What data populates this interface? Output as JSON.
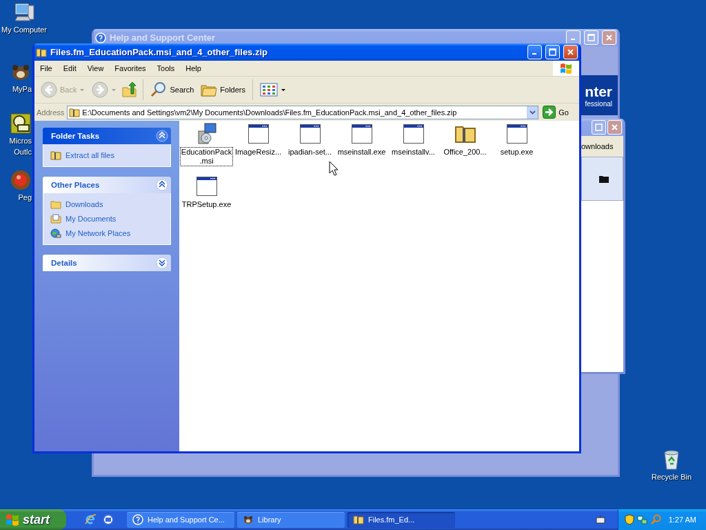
{
  "desktop_icons": [
    {
      "lines": [
        "My Computer"
      ],
      "kind": "computer"
    },
    {
      "lines": [
        "MyPa"
      ],
      "kind": "pets"
    },
    {
      "lines": [
        "Micros",
        "Outlc"
      ],
      "kind": "outlook"
    },
    {
      "lines": [
        "Peg"
      ],
      "kind": "ball"
    },
    {
      "lines": [
        "Recycle Bin"
      ],
      "kind": "recycle"
    }
  ],
  "help_window": {
    "title": "Help and Support Center",
    "heading": "nter",
    "subheading": "fessional"
  },
  "library_window": {
    "tab": "ownloads"
  },
  "window": {
    "title": "Files.fm_EducationPack.msi_and_4_other_files.zip",
    "menu": [
      "File",
      "Edit",
      "View",
      "Favorites",
      "Tools",
      "Help"
    ],
    "toolbar": {
      "back": "Back",
      "search": "Search",
      "folders": "Folders"
    },
    "address": {
      "label": "Address",
      "value": "E:\\Documents and Settings\\vm2\\My Documents\\Downloads\\Files.fm_EducationPack.msi_and_4_other_files.zip",
      "go": "Go"
    },
    "sections": [
      {
        "title": "Folder Tasks",
        "kind": "special",
        "expanded": true,
        "items": [
          {
            "label": "Extract all files",
            "kind": "zip"
          }
        ]
      },
      {
        "title": "Other Places",
        "kind": "normal",
        "expanded": true,
        "items": [
          {
            "label": "Downloads",
            "kind": "folder"
          },
          {
            "label": "My Documents",
            "kind": "documents"
          },
          {
            "label": "My Network Places",
            "kind": "network"
          }
        ]
      },
      {
        "title": "Details",
        "kind": "normal",
        "expanded": false
      }
    ],
    "files": [
      {
        "lines": [
          "EducationPack",
          ".msi"
        ],
        "kind": "msi",
        "selected": true
      },
      {
        "lines": [
          "ImageResiz..."
        ],
        "kind": "exe",
        "selected": false
      },
      {
        "lines": [
          "ipadian-set..."
        ],
        "kind": "exe",
        "selected": false
      },
      {
        "lines": [
          "mseinstall.exe"
        ],
        "kind": "exe",
        "selected": false
      },
      {
        "lines": [
          "mseinstallv..."
        ],
        "kind": "exe",
        "selected": false
      },
      {
        "lines": [
          "Office_200..."
        ],
        "kind": "zip",
        "selected": false
      },
      {
        "lines": [
          "setup.exe"
        ],
        "kind": "exe",
        "selected": false
      },
      {
        "lines": [
          "TRPSetup.exe"
        ],
        "kind": "exe",
        "selected": false
      }
    ]
  },
  "taskbar": {
    "start": "start",
    "tasks": [
      {
        "label": "Help and Support Ce...",
        "kind": "help",
        "selected": false
      },
      {
        "label": "Library",
        "kind": "pets",
        "selected": false
      },
      {
        "label": "Files.fm_Ed...",
        "kind": "zip",
        "selected": true
      }
    ],
    "clock": "1:27 AM"
  }
}
